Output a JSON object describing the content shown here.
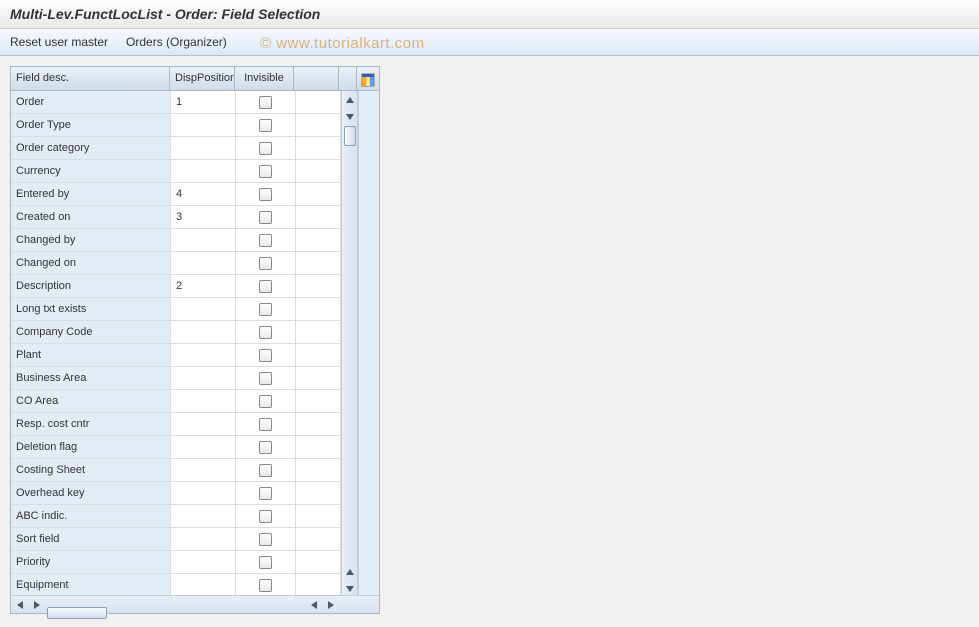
{
  "title": "Multi-Lev.FunctLocList - Order: Field Selection",
  "toolbar": {
    "reset_user_master": "Reset user master",
    "orders_organizer": "Orders (Organizer)"
  },
  "watermark": "© www.tutorialkart.com",
  "table": {
    "headers": {
      "field_desc": "Field desc.",
      "disp_position": "DispPosition",
      "invisible": "Invisible"
    },
    "rows": [
      {
        "label": "Order",
        "position": "1",
        "invisible": false
      },
      {
        "label": "Order Type",
        "position": "",
        "invisible": false
      },
      {
        "label": "Order category",
        "position": "",
        "invisible": false
      },
      {
        "label": "Currency",
        "position": "",
        "invisible": false
      },
      {
        "label": "Entered by",
        "position": "4",
        "invisible": false
      },
      {
        "label": "Created on",
        "position": "3",
        "invisible": false
      },
      {
        "label": "Changed by",
        "position": "",
        "invisible": false
      },
      {
        "label": "Changed on",
        "position": "",
        "invisible": false
      },
      {
        "label": "Description",
        "position": "2",
        "invisible": false
      },
      {
        "label": "Long txt exists",
        "position": "",
        "invisible": false
      },
      {
        "label": "Company Code",
        "position": "",
        "invisible": false
      },
      {
        "label": "Plant",
        "position": "",
        "invisible": false
      },
      {
        "label": "Business Area",
        "position": "",
        "invisible": false
      },
      {
        "label": "CO Area",
        "position": "",
        "invisible": false
      },
      {
        "label": "Resp. cost cntr",
        "position": "",
        "invisible": false
      },
      {
        "label": "Deletion flag",
        "position": "",
        "invisible": false
      },
      {
        "label": "Costing Sheet",
        "position": "",
        "invisible": false
      },
      {
        "label": "Overhead key",
        "position": "",
        "invisible": false
      },
      {
        "label": "ABC indic.",
        "position": "",
        "invisible": false
      },
      {
        "label": "Sort field",
        "position": "",
        "invisible": false
      },
      {
        "label": "Priority",
        "position": "",
        "invisible": false
      },
      {
        "label": "Equipment",
        "position": "",
        "invisible": false
      }
    ]
  },
  "colors": {
    "header_grad_top": "#eaf0f7",
    "header_grad_bot": "#d0dce8",
    "cell_label_bg": "#e3ecf5",
    "border": "#a8b8c8"
  }
}
